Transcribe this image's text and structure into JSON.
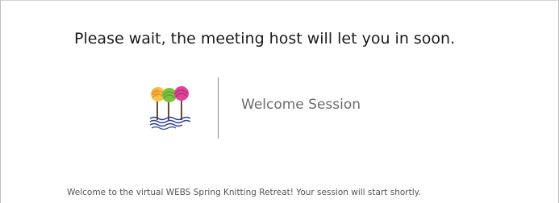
{
  "lobby": {
    "wait_message": "Please wait, the meeting host will let you in soon.",
    "session_title": "Welcome Session",
    "welcome_text": "Welcome to the virtual WEBS Spring Knitting Retreat! Your session will start shortly.",
    "logo_icon": "yarn-trees-logo-icon"
  },
  "colors": {
    "yarn_orange": "#f2a23a",
    "yarn_green": "#7cc242",
    "yarn_magenta": "#d6338f",
    "water_blue": "#2b3f9a"
  }
}
